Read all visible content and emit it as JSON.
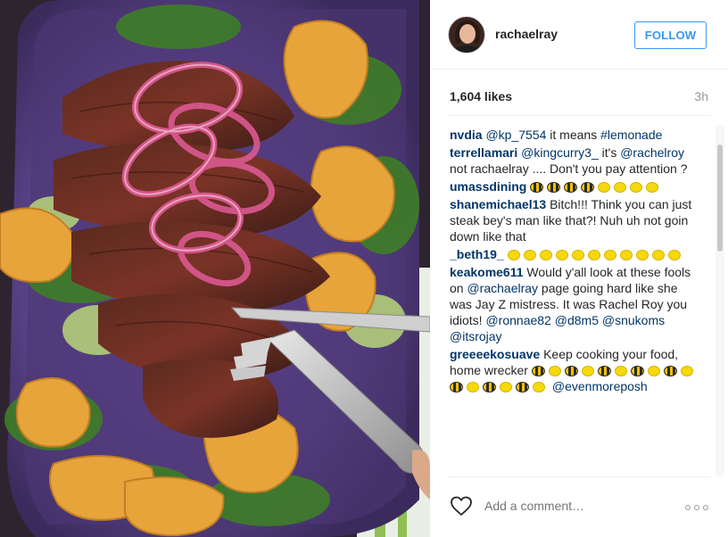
{
  "post": {
    "username": "rachaelray",
    "follow_label": "FOLLOW",
    "likes": "1,604 likes",
    "time": "3h",
    "add_comment_placeholder": "Add a comment…",
    "image_alt": "Grilled skirt steak salad with pickled red onions and potato chips on a purple platter"
  },
  "comments": [
    {
      "user": "nvdia",
      "parts": [
        {
          "t": "link",
          "v": "@kp_7554"
        },
        {
          "t": "text",
          "v": " it means "
        },
        {
          "t": "link",
          "v": "#lemonade"
        }
      ]
    },
    {
      "user": "terrellamari",
      "parts": [
        {
          "t": "link",
          "v": "@kingcurry3_"
        },
        {
          "t": "text",
          "v": " it's "
        },
        {
          "t": "link",
          "v": "@rachelroy"
        },
        {
          "t": "text",
          "v": " not rachaelray .... Don't you pay attention ?"
        }
      ]
    },
    {
      "user": "umassdining",
      "parts": [
        {
          "t": "emoji",
          "v": "bee"
        },
        {
          "t": "emoji",
          "v": "bee"
        },
        {
          "t": "emoji",
          "v": "bee"
        },
        {
          "t": "emoji",
          "v": "bee"
        },
        {
          "t": "emoji",
          "v": "lemon"
        },
        {
          "t": "emoji",
          "v": "lemon"
        },
        {
          "t": "emoji",
          "v": "lemon"
        },
        {
          "t": "emoji",
          "v": "lemon"
        }
      ]
    },
    {
      "user": "shanemichael13",
      "parts": [
        {
          "t": "text",
          "v": " Bitch!!! Think you can just steak bey's man like that?! Nuh uh not goin down like that"
        }
      ]
    },
    {
      "user": "_beth19_",
      "parts": [
        {
          "t": "emoji",
          "v": "lemon"
        },
        {
          "t": "emoji",
          "v": "lemon"
        },
        {
          "t": "emoji",
          "v": "lemon"
        },
        {
          "t": "emoji",
          "v": "lemon"
        },
        {
          "t": "emoji",
          "v": "lemon"
        },
        {
          "t": "emoji",
          "v": "lemon"
        },
        {
          "t": "emoji",
          "v": "lemon"
        },
        {
          "t": "emoji",
          "v": "lemon"
        },
        {
          "t": "emoji",
          "v": "lemon"
        },
        {
          "t": "emoji",
          "v": "lemon"
        },
        {
          "t": "emoji",
          "v": "lemon"
        }
      ]
    },
    {
      "user": "keakome611",
      "parts": [
        {
          "t": "text",
          "v": " Would y'all look at these fools on "
        },
        {
          "t": "link",
          "v": "@rachaelray"
        },
        {
          "t": "text",
          "v": " page going hard like she was Jay Z mistress. It was Rachel Roy you idiots! "
        },
        {
          "t": "link",
          "v": "@ronnae82"
        },
        {
          "t": "text",
          "v": " "
        },
        {
          "t": "link",
          "v": "@d8m5"
        },
        {
          "t": "text",
          "v": " "
        },
        {
          "t": "link",
          "v": "@snukoms"
        },
        {
          "t": "text",
          "v": " "
        },
        {
          "t": "link",
          "v": "@itsrojay"
        }
      ]
    },
    {
      "user": "greeeekosuave",
      "parts": [
        {
          "t": "text",
          "v": " Keep cooking your food, home wrecker "
        },
        {
          "t": "emoji",
          "v": "bee"
        },
        {
          "t": "emoji",
          "v": "lemon"
        },
        {
          "t": "emoji",
          "v": "bee"
        },
        {
          "t": "emoji",
          "v": "lemon"
        },
        {
          "t": "emoji",
          "v": "bee"
        },
        {
          "t": "emoji",
          "v": "lemon"
        },
        {
          "t": "emoji",
          "v": "bee"
        },
        {
          "t": "emoji",
          "v": "lemon"
        },
        {
          "t": "emoji",
          "v": "bee"
        },
        {
          "t": "emoji",
          "v": "lemon"
        },
        {
          "t": "emoji",
          "v": "bee"
        },
        {
          "t": "emoji",
          "v": "lemon"
        },
        {
          "t": "emoji",
          "v": "bee"
        },
        {
          "t": "emoji",
          "v": "lemon"
        },
        {
          "t": "emoji",
          "v": "bee"
        },
        {
          "t": "emoji",
          "v": "lemon"
        },
        {
          "t": "text",
          "v": " "
        },
        {
          "t": "link",
          "v": "@evenmoreposh"
        }
      ]
    }
  ],
  "colors": {
    "link": "#003569",
    "follow": "#3897f0",
    "muted": "#999999"
  },
  "icons": {
    "heart": "heart-outline-icon",
    "more": "more-options-icon"
  }
}
